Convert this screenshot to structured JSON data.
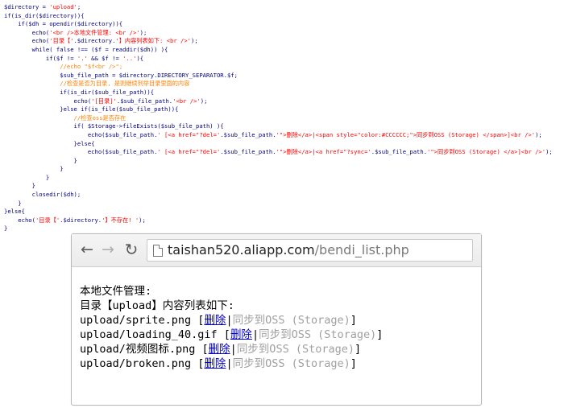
{
  "code": {
    "lines": [
      {
        "parts": [
          {
            "t": "$directory = "
          },
          {
            "t": "'upload'",
            "c": "str"
          },
          {
            "t": ";"
          }
        ]
      },
      {
        "parts": [
          {
            "t": "if(is_dir($directory)){"
          }
        ]
      },
      {
        "parts": [
          {
            "t": "    if($dh = opendir($directory)){"
          }
        ]
      },
      {
        "parts": [
          {
            "t": "        echo("
          },
          {
            "t": "'<br />本地文件管理: <br />'",
            "c": "str"
          },
          {
            "t": ");"
          }
        ]
      },
      {
        "parts": [
          {
            "t": "        echo("
          },
          {
            "t": "'目录【'",
            "c": "str"
          },
          {
            "t": ".$directory."
          },
          {
            "t": "'】内容列表如下: <br />'",
            "c": "str"
          },
          {
            "t": ");"
          }
        ]
      },
      {
        "parts": [
          {
            "t": "        while( false !== ($f = readdir($dh)) ){"
          }
        ]
      },
      {
        "parts": [
          {
            "t": "            if($f != "
          },
          {
            "t": "'.'",
            "c": "str"
          },
          {
            "t": " && $f != "
          },
          {
            "t": "'..'",
            "c": "str"
          },
          {
            "t": "){"
          }
        ]
      },
      {
        "parts": [
          {
            "t": "                "
          },
          {
            "t": "//echo \"$f<br />\";",
            "c": "cmt"
          }
        ]
      },
      {
        "parts": [
          {
            "t": "                $sub_file_path = $directory.DIRECTORY_SEPARATOR.$f;"
          }
        ]
      },
      {
        "parts": [
          {
            "t": "                "
          },
          {
            "t": "//检查是否为目录, 是则继续列举目录里面的内容",
            "c": "cmt"
          }
        ]
      },
      {
        "parts": [
          {
            "t": "                if(is_dir($sub_file_path)){"
          }
        ]
      },
      {
        "parts": [
          {
            "t": "                    echo("
          },
          {
            "t": "'[目录]'",
            "c": "str"
          },
          {
            "t": ".$sub_file_path."
          },
          {
            "t": "'<br />'",
            "c": "str"
          },
          {
            "t": ");"
          }
        ]
      },
      {
        "parts": [
          {
            "t": "                }else if(is_file($sub_file_path)){"
          }
        ]
      },
      {
        "parts": [
          {
            "t": "                    "
          },
          {
            "t": "//检查oss是否存在",
            "c": "cmt"
          }
        ]
      },
      {
        "parts": [
          {
            "t": "                    if( $Storage->fileExists($sub_file_path) ){"
          }
        ]
      },
      {
        "parts": [
          {
            "t": "                        echo($sub_file_path."
          },
          {
            "t": "' [<a href=\"?del='",
            "c": "str"
          },
          {
            "t": ".$sub_file_path."
          },
          {
            "t": "'\">删除</a>|<span style=\"color:#CCCCCC;\">同步到OSS (Storage) </span>]<br />'",
            "c": "str"
          },
          {
            "t": ");"
          }
        ]
      },
      {
        "parts": [
          {
            "t": "                    }else{"
          }
        ]
      },
      {
        "parts": [
          {
            "t": "                        echo($sub_file_path."
          },
          {
            "t": "' [<a href=\"?del='",
            "c": "str"
          },
          {
            "t": ".$sub_file_path."
          },
          {
            "t": "'\">删除</a>|<a href=\"?sync='",
            "c": "str"
          },
          {
            "t": ".$sub_file_path."
          },
          {
            "t": "'\">同步到OSS (Storage) </a>]<br />'",
            "c": "str"
          },
          {
            "t": ");"
          }
        ]
      },
      {
        "parts": [
          {
            "t": "                    }"
          }
        ]
      },
      {
        "parts": [
          {
            "t": "                }"
          }
        ]
      },
      {
        "parts": [
          {
            "t": "            }"
          }
        ]
      },
      {
        "parts": [
          {
            "t": "        }"
          }
        ]
      },
      {
        "parts": [
          {
            "t": "        closedir($dh);"
          }
        ]
      },
      {
        "parts": [
          {
            "t": "    }"
          }
        ]
      },
      {
        "parts": [
          {
            "t": "}else{"
          }
        ]
      },
      {
        "parts": [
          {
            "t": "    echo("
          },
          {
            "t": "'目录【'",
            "c": "str"
          },
          {
            "t": ".$directory."
          },
          {
            "t": "'】不存在! '",
            "c": "str"
          },
          {
            "t": ");"
          }
        ]
      },
      {
        "parts": [
          {
            "t": "}"
          }
        ]
      }
    ]
  },
  "browser": {
    "url_host": "taishan520.aliapp.com",
    "url_path": "/bendi_list.php",
    "icons": {
      "back": "back-arrow-icon",
      "forward": "forward-arrow-icon",
      "reload": "reload-icon",
      "page": "page-icon"
    }
  },
  "page": {
    "heading": "本地文件管理:",
    "subheading": "目录【upload】内容列表如下:",
    "delete_label": "删除",
    "sync_label": "同步到OSS (Storage)",
    "files": [
      "upload/sprite.png",
      "upload/loading_40.gif",
      "upload/视频图标.png",
      "upload/broken.png"
    ]
  },
  "colors": {
    "code_text": "#000080",
    "code_string": "#ff0000",
    "code_comment": "#ff8000",
    "link": "#0000cc",
    "disabled": "#a0a0a0"
  }
}
